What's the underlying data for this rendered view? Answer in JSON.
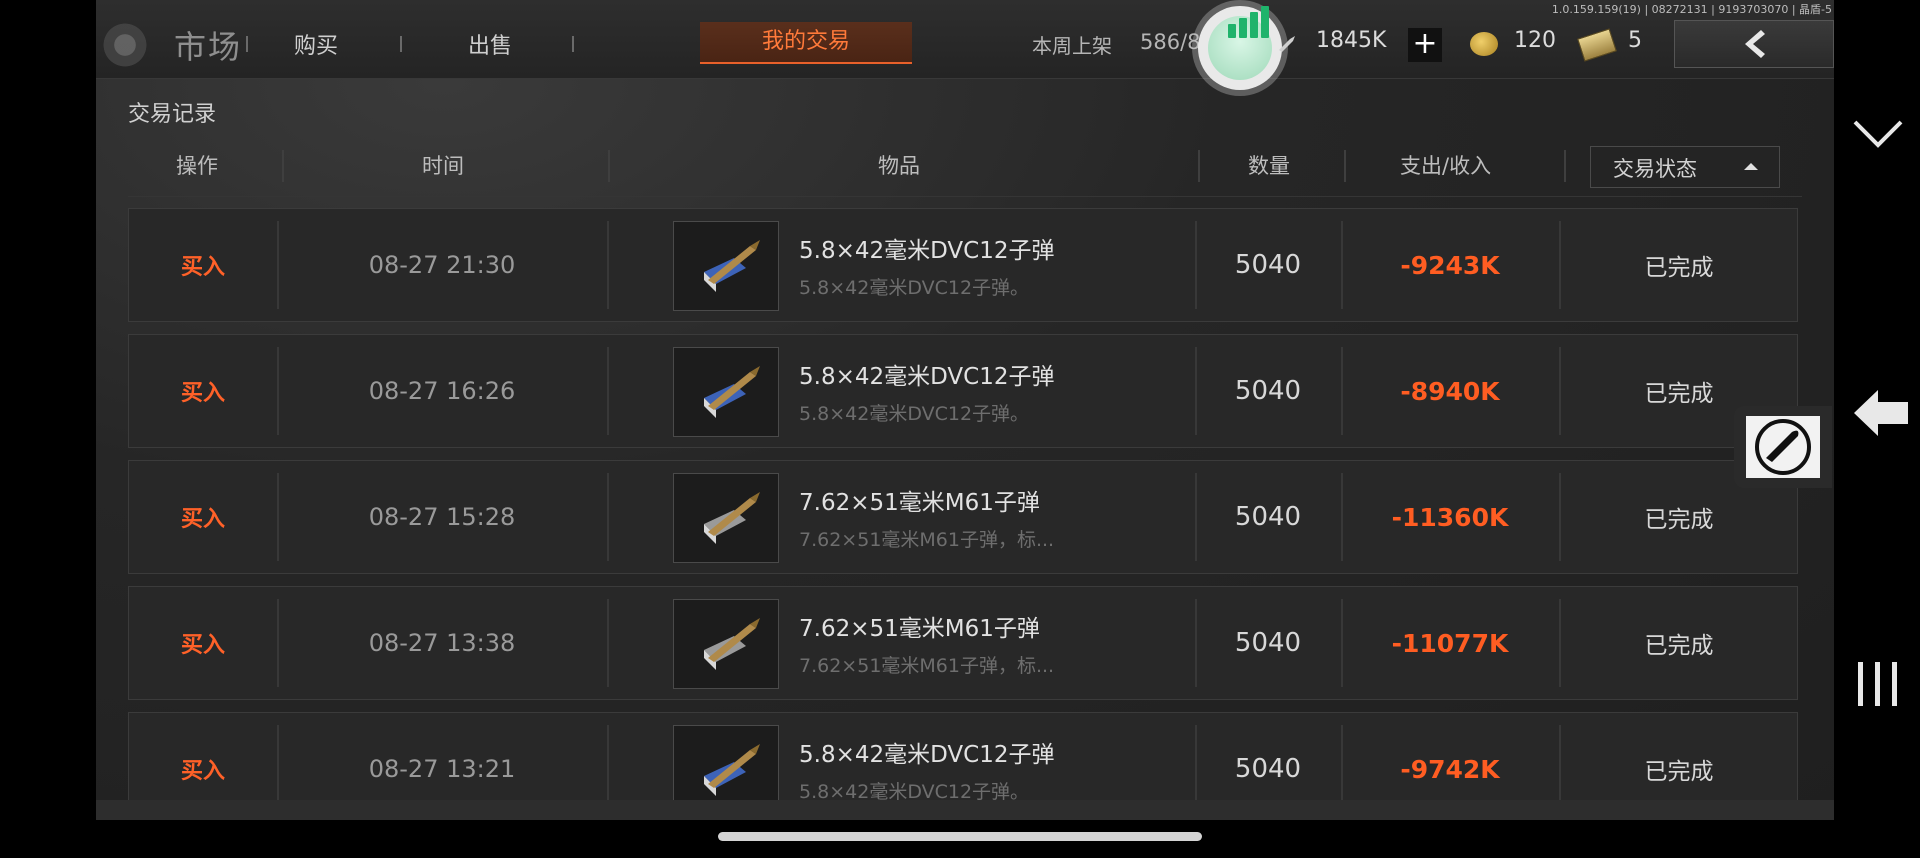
{
  "topbar": {
    "version": "1.0.159.159(19) | 08272131 | 9193703070 | 晶盾-5",
    "market_title": "市场",
    "tabs": [
      "购买",
      "出售",
      "我的交易"
    ],
    "active_tab_index": 2,
    "week_listing_label": "本周上架",
    "week_listing_count": "586/8",
    "currency_amount": "1845K",
    "coin_amount": "120",
    "ticket_amount": "5",
    "plus_label": "+"
  },
  "section_title": "交易记录",
  "table": {
    "headers": [
      "操作",
      "时间",
      "物品",
      "数量",
      "支出/收入",
      "交易状态"
    ],
    "sort_column": "交易状态",
    "sort_direction": "up",
    "rows": [
      {
        "action": "买入",
        "time": "08-27 21:30",
        "item": "5.8×42毫米DVC12子弹",
        "desc": "5.8×42毫米DVC12子弹。",
        "qty": "5040",
        "amount": "-9243K",
        "status": "已完成"
      },
      {
        "action": "买入",
        "time": "08-27 16:26",
        "item": "5.8×42毫米DVC12子弹",
        "desc": "5.8×42毫米DVC12子弹。",
        "qty": "5040",
        "amount": "-8940K",
        "status": "已完成"
      },
      {
        "action": "买入",
        "time": "08-27 15:28",
        "item": "7.62×51毫米M61子弹",
        "desc": "7.62×51毫米M61子弹，标...",
        "qty": "5040",
        "amount": "-11360K",
        "status": "已完成"
      },
      {
        "action": "买入",
        "time": "08-27 13:38",
        "item": "7.62×51毫米M61子弹",
        "desc": "7.62×51毫米M61子弹，标...",
        "qty": "5040",
        "amount": "-11077K",
        "status": "已完成"
      },
      {
        "action": "买入",
        "time": "08-27 13:21",
        "item": "5.8×42毫米DVC12子弹",
        "desc": "5.8×42毫米DVC12子弹。",
        "qty": "5040",
        "amount": "-9742K",
        "status": "已完成"
      }
    ]
  },
  "colors": {
    "accent": "#ff6128",
    "bg": "#262626",
    "stats_green": "#1fb36b"
  },
  "icons": [
    "logo-icon",
    "stats-icon",
    "bullet-currency-icon",
    "coin-icon",
    "ticket-icon",
    "back-chevron-icon",
    "sort-up-icon",
    "ammo-thumbnail-icon",
    "chevron-down-icon",
    "arrow-left-icon",
    "bullet-icon",
    "recent-apps-icon"
  ]
}
